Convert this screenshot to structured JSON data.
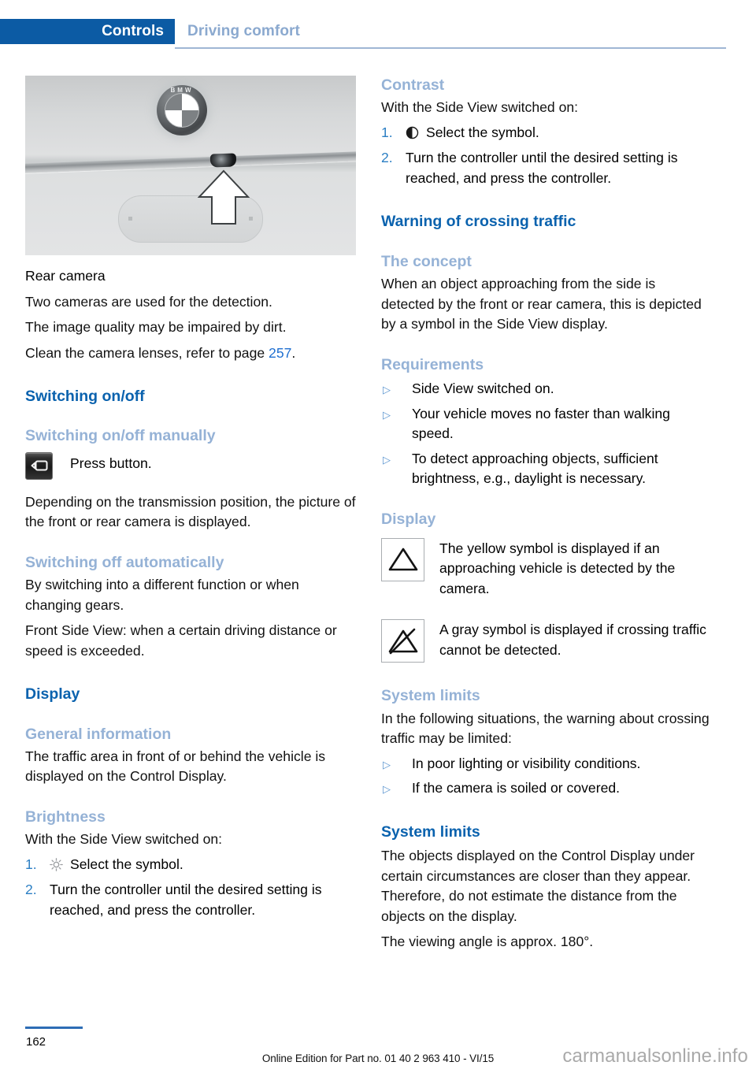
{
  "header": {
    "active_tab": "Controls",
    "inactive_tab": "Driving comfort"
  },
  "left_column": {
    "figure_caption": "Rear camera",
    "paragraphs_after_figure": [
      "Two cameras are used for the detection.",
      "The image quality may be impaired by dirt."
    ],
    "clean_lenses_pre": "Clean the camera lenses, refer to page ",
    "clean_lenses_page": "257",
    "clean_lenses_post": ".",
    "switching_on_off_h1": "Switching on/off",
    "switching_manually_h2": "Switching on/off manually",
    "press_button_label": "Press button.",
    "transmission_paragraph": "Depending on the transmission position, the picture of the front or rear camera is displayed.",
    "switching_auto_h2": "Switching off automatically",
    "switching_auto_p1": "By switching into a different function or when changing gears.",
    "switching_auto_p2": "Front Side View: when a certain driving distance or speed is exceeded.",
    "display_h1": "Display",
    "general_info_h2": "General information",
    "general_info_p": "The traffic area in front of or behind the vehicle is displayed on the Control Display.",
    "brightness_h2": "Brightness",
    "brightness_intro": "With the Side View switched on:",
    "brightness_steps": [
      {
        "num": "1.",
        "symbol": "brightness-sun-symbol",
        "text": "Select the symbol."
      },
      {
        "num": "2.",
        "symbol": "",
        "text": "Turn the controller until the desired setting is reached, and press the controller."
      }
    ]
  },
  "right_column": {
    "contrast_h2": "Contrast",
    "contrast_intro": "With the Side View switched on:",
    "contrast_steps": [
      {
        "num": "1.",
        "symbol": "contrast-half-circle-symbol",
        "text": "Select the symbol."
      },
      {
        "num": "2.",
        "symbol": "",
        "text": "Turn the controller until the desired setting is reached, and press the controller."
      }
    ],
    "warning_h1": "Warning of crossing traffic",
    "concept_h2": "The concept",
    "concept_p": "When an object approaching from the side is detected by the front or rear camera, this is depicted by a symbol in the Side View display.",
    "requirements_h2": "Requirements",
    "requirements": [
      "Side View switched on.",
      "Your vehicle moves no faster than walking speed.",
      "To detect approaching objects, sufficient brightness, e.g., daylight is necessary."
    ],
    "display_h2": "Display",
    "display_symbols": [
      {
        "icon": "warning-triangle-symbol",
        "text": "The yellow symbol is displayed if an approaching vehicle is detected by the camera."
      },
      {
        "icon": "warning-triangle-crossed-out-symbol",
        "text": "A gray symbol is displayed if crossing traffic cannot be detected."
      }
    ],
    "system_limits_h2": "System limits",
    "system_limits_intro": "In the following situations, the warning about crossing traffic may be limited:",
    "system_limits_items": [
      "In poor lighting or visibility conditions.",
      "If the camera is soiled or covered."
    ],
    "system_limits_h1": "System limits",
    "system_limits_p1": "The objects displayed on the Control Display under certain circumstances are closer than they appear. Therefore, do not estimate the distance from the objects on the display.",
    "system_limits_p2": "The viewing angle is approx. 180°."
  },
  "footer": {
    "page_number": "162",
    "edition": "Online Edition for Part no. 01 40 2 963 410 - VI/15",
    "watermark": "carmanualsonline.info"
  },
  "colors": {
    "tab_blue": "#0c5ba4",
    "heading_blue": "#0a62ae",
    "subheading_blue": "#95b2d6",
    "link_blue": "#1f6fd0",
    "bullet_blue": "#5a94cf"
  }
}
